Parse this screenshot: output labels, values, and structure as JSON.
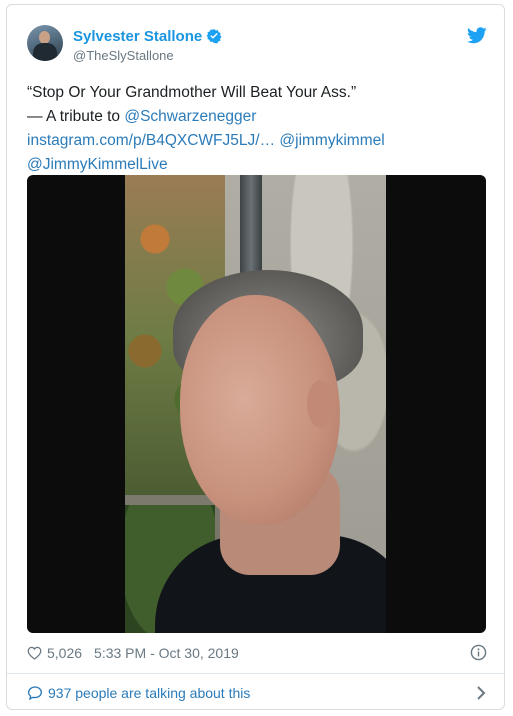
{
  "author": {
    "display_name": "Sylvester Stallone",
    "handle": "@TheSlyStallone",
    "verified": true,
    "avatar_icon": "avatar-photo"
  },
  "platform_icon": "twitter-bird-icon",
  "tweet": {
    "quote": "“Stop Or Your Grandmother Will Beat Your Ass.”",
    "tribute_prefix": "— A tribute to ",
    "mention_schwarzenegger": "@Schwarzenegger",
    "instagram_link": "instagram.com/p/B4QXCWFJ5LJ/…",
    "mention_jimmykimmel": "@jimmykimmel",
    "mention_jimmykimmellive": "@JimmyKimmelLive"
  },
  "media": {
    "type": "video-thumbnail"
  },
  "footer": {
    "like_count": "5,026",
    "timestamp": "5:33 PM - Oct 30, 2019"
  },
  "conversation": {
    "text": "937 people are talking about this"
  },
  "colors": {
    "link": "#2b7bb9",
    "name": "#1b95e0",
    "muted": "#697882",
    "text": "#1c2022",
    "border": "#d8dde1"
  }
}
